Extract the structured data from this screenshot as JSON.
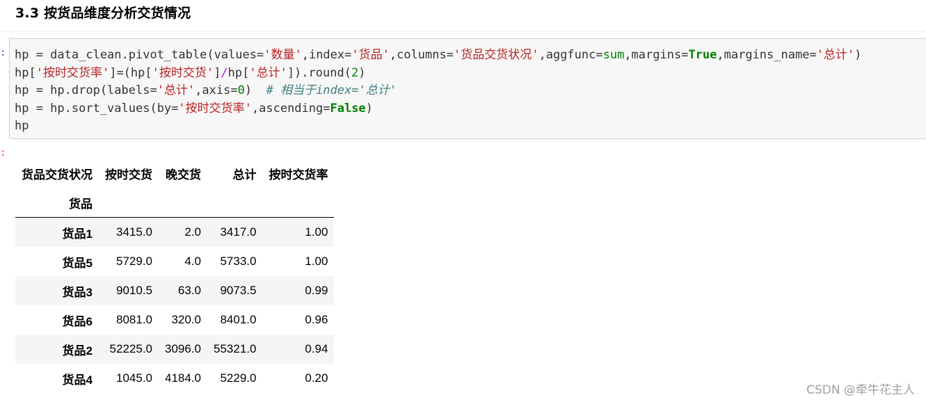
{
  "markdown": {
    "heading": "3.3 按货品维度分析交货情况"
  },
  "code": {
    "line1": {
      "p1": "hp = data_clean.pivot_table(values=",
      "s1": "'数量'",
      "p2": ",index=",
      "s2": "'货品'",
      "p3": ",columns=",
      "s3": "'货品交货状况'",
      "p4": ",aggfunc=",
      "k1": "sum",
      "p5": ",margins=",
      "k2": "True",
      "p6": ",margins_name=",
      "s4": "'总计'",
      "p7": ")"
    },
    "line2": {
      "p1": "hp[",
      "s1": "'按时交货率'",
      "p2": "]=(hp[",
      "s2": "'按时交货'",
      "p3": "]",
      "op": "/",
      "p4": "hp[",
      "s3": "'总计'",
      "p5": "]).round(",
      "n1": "2",
      "p6": ")"
    },
    "line3": {
      "p1": "hp = hp.drop(labels=",
      "s1": "'总计'",
      "p2": ",axis=",
      "n1": "0",
      "p3": ")  ",
      "c1": "# 相当于index='总计'"
    },
    "line4": {
      "p1": "hp = hp.sort_values(by=",
      "s1": "'按时交货率'",
      "p2": ",ascending=",
      "k1": "False",
      "p3": ")"
    },
    "line5": {
      "p1": "hp"
    }
  },
  "dataframe": {
    "columns_name": "货品交货状况",
    "columns": [
      "按时交货",
      "晚交货",
      "总计",
      "按时交货率"
    ],
    "index_name": "货品",
    "rows": [
      {
        "index": "货品1",
        "values": [
          "3415.0",
          "2.0",
          "3417.0",
          "1.00"
        ]
      },
      {
        "index": "货品5",
        "values": [
          "5729.0",
          "4.0",
          "5733.0",
          "1.00"
        ]
      },
      {
        "index": "货品3",
        "values": [
          "9010.5",
          "63.0",
          "9073.5",
          "0.99"
        ]
      },
      {
        "index": "货品6",
        "values": [
          "8081.0",
          "320.0",
          "8401.0",
          "0.96"
        ]
      },
      {
        "index": "货品2",
        "values": [
          "52225.0",
          "3096.0",
          "55321.0",
          "0.94"
        ]
      },
      {
        "index": "货品4",
        "values": [
          "1045.0",
          "4184.0",
          "5229.0",
          "0.20"
        ]
      }
    ]
  },
  "watermark": "CSDN @牵牛花主人",
  "colors": {
    "string": "#ba2121",
    "keyword": "#008000",
    "number": "#008000",
    "operator": "#aa22ff",
    "comment": "#408080",
    "cell_background": "#f7f7f7",
    "stripe": "#f5f5f5"
  }
}
